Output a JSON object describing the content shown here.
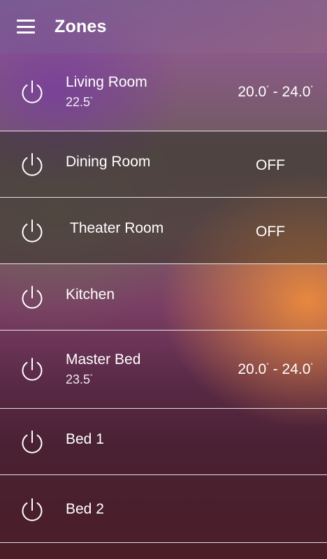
{
  "header": {
    "title": "Zones",
    "menu_icon": "menu-icon"
  },
  "zones": [
    {
      "name": "Living Room",
      "temp": "22.5",
      "range_low": "20.0",
      "range_high": "24.0",
      "status": ""
    },
    {
      "name": "Dining Room",
      "temp": "",
      "status": "OFF"
    },
    {
      "name": "Theater Room",
      "temp": "",
      "status": "OFF"
    },
    {
      "name": "Kitchen",
      "temp": "",
      "status": ""
    },
    {
      "name": "Master Bed",
      "temp": "23.5",
      "range_low": "20.0",
      "range_high": "24.0",
      "status": ""
    },
    {
      "name": "Bed 1",
      "temp": "",
      "status": ""
    },
    {
      "name": "Bed 2",
      "temp": "",
      "status": ""
    }
  ],
  "units": {
    "degree": "°"
  },
  "colors": {
    "text": "#ffffff",
    "accent_orange": "#ec8c3c",
    "accent_purple": "#7c5a8e"
  }
}
